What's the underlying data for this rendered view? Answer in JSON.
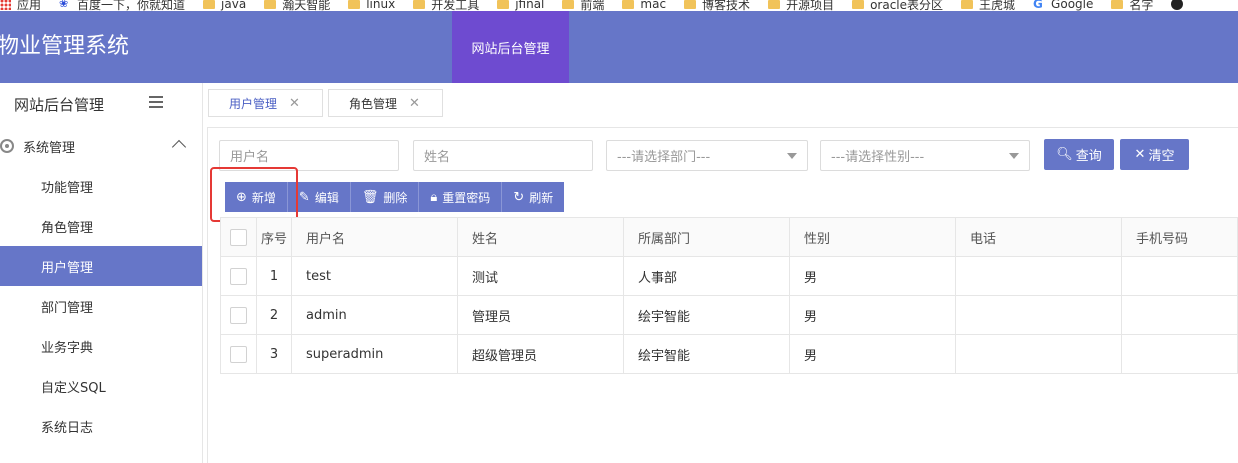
{
  "bookmarks": [
    {
      "label": "应用",
      "icon": "apps-icon"
    },
    {
      "label": "百度一下，你就知道",
      "icon": "baidu-icon"
    },
    {
      "label": "java",
      "icon": "folder-icon"
    },
    {
      "label": "瀚天智能",
      "icon": "folder-icon"
    },
    {
      "label": "linux",
      "icon": "folder-icon"
    },
    {
      "label": "开发工具",
      "icon": "folder-icon"
    },
    {
      "label": "jfinal",
      "icon": "folder-icon"
    },
    {
      "label": "前端",
      "icon": "folder-icon"
    },
    {
      "label": "mac",
      "icon": "folder-icon"
    },
    {
      "label": "博客技术",
      "icon": "folder-icon"
    },
    {
      "label": "开源项目",
      "icon": "folder-icon"
    },
    {
      "label": "oracle表分区",
      "icon": "folder-icon"
    },
    {
      "label": "王虎城",
      "icon": "folder-icon"
    },
    {
      "label": "Google",
      "icon": "google-icon"
    },
    {
      "label": "名字",
      "icon": "folder-icon"
    }
  ],
  "header": {
    "title": "物业管理系统",
    "top_tab": "网站后台管理"
  },
  "sidebar": {
    "title": "网站后台管理",
    "group_label": "系统管理",
    "items": [
      {
        "label": "功能管理",
        "active": false
      },
      {
        "label": "角色管理",
        "active": false
      },
      {
        "label": "用户管理",
        "active": true
      },
      {
        "label": "部门管理",
        "active": false
      },
      {
        "label": "业务字典",
        "active": false
      },
      {
        "label": "自定义SQL",
        "active": false
      },
      {
        "label": "系统日志",
        "active": false
      }
    ]
  },
  "tabs": [
    {
      "label": "用户管理",
      "active": true
    },
    {
      "label": "角色管理",
      "active": false
    }
  ],
  "search": {
    "username_placeholder": "用户名",
    "name_placeholder": "姓名",
    "dept_placeholder": "---请选择部门---",
    "gender_placeholder": "---请选择性别---",
    "query_label": "查询",
    "clear_label": "清空"
  },
  "toolbar": {
    "add": "新增",
    "edit": "编辑",
    "delete": "删除",
    "reset_password": "重置密码",
    "refresh": "刷新"
  },
  "table": {
    "columns": [
      "序号",
      "用户名",
      "姓名",
      "所属部门",
      "性别",
      "电话",
      "手机号码"
    ],
    "rows": [
      {
        "no": "1",
        "username": "test",
        "name": "测试",
        "dept": "人事部",
        "gender": "男",
        "phone": "",
        "mobile": ""
      },
      {
        "no": "2",
        "username": "admin",
        "name": "管理员",
        "dept": "绘宇智能",
        "gender": "男",
        "phone": "",
        "mobile": ""
      },
      {
        "no": "3",
        "username": "superadmin",
        "name": "超级管理员",
        "dept": "绘宇智能",
        "gender": "男",
        "phone": "",
        "mobile": ""
      }
    ]
  },
  "colors": {
    "primary": "#6676c8",
    "top_tab_active": "#6e4bd0",
    "highlight": "#e53935"
  }
}
